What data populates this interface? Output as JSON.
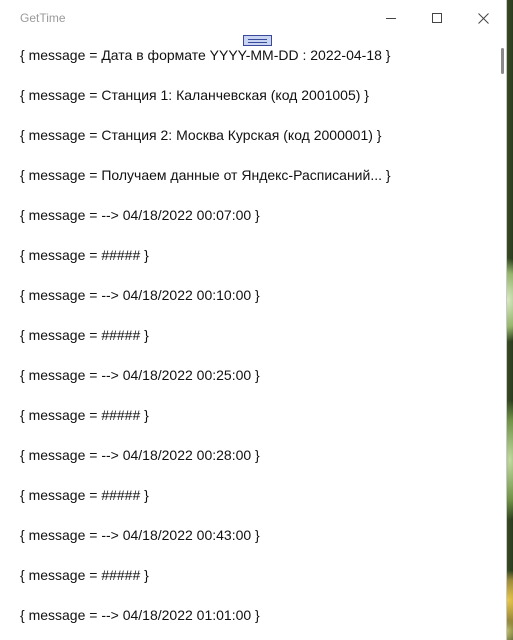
{
  "window": {
    "title": "GetTime",
    "controls": {
      "minimize_icon": "minimize-icon",
      "maximize_icon": "maximize-icon",
      "close_icon": "close-icon"
    }
  },
  "messages": [
    "{ message = Дата в формате YYYY-MM-DD : 2022-04-18 }",
    "{ message = Станция 1: Каланчевская (код 2001005) }",
    "{ message = Станция 2: Москва Курская (код 2000001) }",
    "{ message = Получаем данные от Яндекс-Расписаний... }",
    "{ message = --> 04/18/2022 00:07:00 }",
    "{ message = ##### }",
    "{ message = --> 04/18/2022 00:10:00 }",
    "{ message = ##### }",
    "{ message = --> 04/18/2022 00:25:00 }",
    "{ message = ##### }",
    "{ message = --> 04/18/2022 00:28:00 }",
    "{ message = ##### }",
    "{ message = --> 04/18/2022 00:43:00 }",
    "{ message = ##### }",
    "{ message = --> 04/18/2022 01:01:00 }"
  ]
}
